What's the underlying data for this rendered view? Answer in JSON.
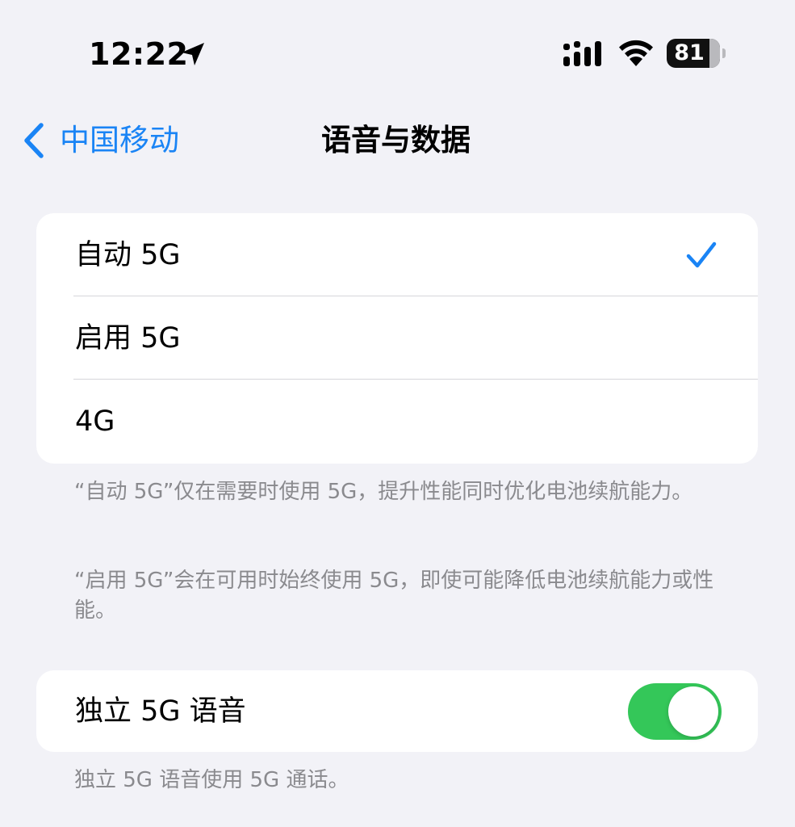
{
  "status_bar": {
    "time": "12:22",
    "battery_level": "81",
    "battery_fraction": 0.81,
    "icons": [
      "location-arrow-icon",
      "cellular-signal-icon",
      "wifi-icon",
      "battery-icon"
    ]
  },
  "nav": {
    "back_label": "中国移动",
    "title": "语音与数据"
  },
  "network_options": {
    "items": [
      {
        "label": "自动 5G",
        "selected": true
      },
      {
        "label": "启用 5G",
        "selected": false
      },
      {
        "label": "4G",
        "selected": false
      }
    ],
    "footnote_1": "“自动 5G”仅在需要时使用 5G，提升性能同时优化电池续航能力。",
    "footnote_2": "“启用 5G”会在可用时始终使用 5G，即使可能降低电池续航能力或性能。"
  },
  "voice": {
    "label": "独立 5G 语音",
    "enabled": true,
    "footnote": "独立 5G 语音使用 5G 通话。"
  },
  "colors": {
    "accent": "#1a84f5",
    "toggle_on": "#34c759",
    "background": "#f2f2f7",
    "secondary_text": "#8a8a8e"
  }
}
